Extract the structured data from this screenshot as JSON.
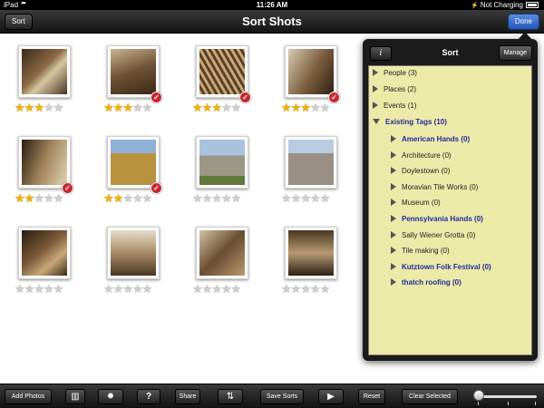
{
  "status_bar": {
    "device": "iPad",
    "time": "11:26 AM",
    "charging": "Not Charging"
  },
  "nav": {
    "sort_label": "Sort",
    "title": "Sort Shots",
    "done_label": "Done"
  },
  "accent_done": "#2355b5",
  "photos": [
    {
      "rating": 3,
      "selected": false,
      "tone": "sepia-interior"
    },
    {
      "rating": 3,
      "selected": true,
      "tone": "sepia-hands"
    },
    {
      "rating": 3,
      "selected": true,
      "tone": "sepia-straw"
    },
    {
      "rating": 3,
      "selected": true,
      "tone": "sepia-worker"
    },
    {
      "rating": 2,
      "selected": true,
      "tone": "sepia-weaver"
    },
    {
      "rating": 2,
      "selected": true,
      "tone": "color-field"
    },
    {
      "rating": 0,
      "selected": false,
      "tone": "color-house"
    },
    {
      "rating": 0,
      "selected": false,
      "tone": "color-town"
    },
    {
      "rating": 0,
      "selected": false,
      "tone": "sepia-table"
    },
    {
      "rating": 0,
      "selected": false,
      "tone": "sepia-shop"
    },
    {
      "rating": 0,
      "selected": false,
      "tone": "sepia-tiles"
    },
    {
      "rating": 0,
      "selected": false,
      "tone": "sepia-room"
    }
  ],
  "popover": {
    "title": "Sort",
    "info_label": "i",
    "manage_label": "Manage",
    "sections": [
      {
        "label": "People",
        "count": "(3)",
        "expanded": false
      },
      {
        "label": "Places",
        "count": "(2)",
        "expanded": false
      },
      {
        "label": "Events",
        "count": "(1)",
        "expanded": false
      },
      {
        "label": "Existing Tags",
        "count": "(10)",
        "expanded": true
      }
    ],
    "tags": [
      {
        "label": "American Hands",
        "count": "(0)",
        "highlight": true
      },
      {
        "label": "Architecture",
        "count": "(0)",
        "highlight": false
      },
      {
        "label": "Doylestown",
        "count": "(0)",
        "highlight": false
      },
      {
        "label": "Moravian Tile Works",
        "count": "(0)",
        "highlight": false
      },
      {
        "label": "Museum",
        "count": "(0)",
        "highlight": false
      },
      {
        "label": "Pennsylvania Hands",
        "count": "(0)",
        "highlight": true
      },
      {
        "label": "Sally Wiener Grotta",
        "count": "(0)",
        "highlight": false
      },
      {
        "label": "Tile making",
        "count": "(0)",
        "highlight": false
      },
      {
        "label": "Kutztown Folk Festival",
        "count": "(0)",
        "highlight": true
      },
      {
        "label": "thatch roofing",
        "count": "(0)",
        "highlight": true
      }
    ]
  },
  "toolbar": {
    "add_photos": "Add Photos",
    "trash_icon": "trash-icon",
    "settings_icon": "gear-icon",
    "help_label": "?",
    "share": "Share",
    "sort_order_icon": "sort-order-icon",
    "save_sorts": "Save Sorts",
    "play_icon": "play-icon",
    "reset": "Reset",
    "clear_selected": "Clear Selected",
    "slider_value": 0
  }
}
